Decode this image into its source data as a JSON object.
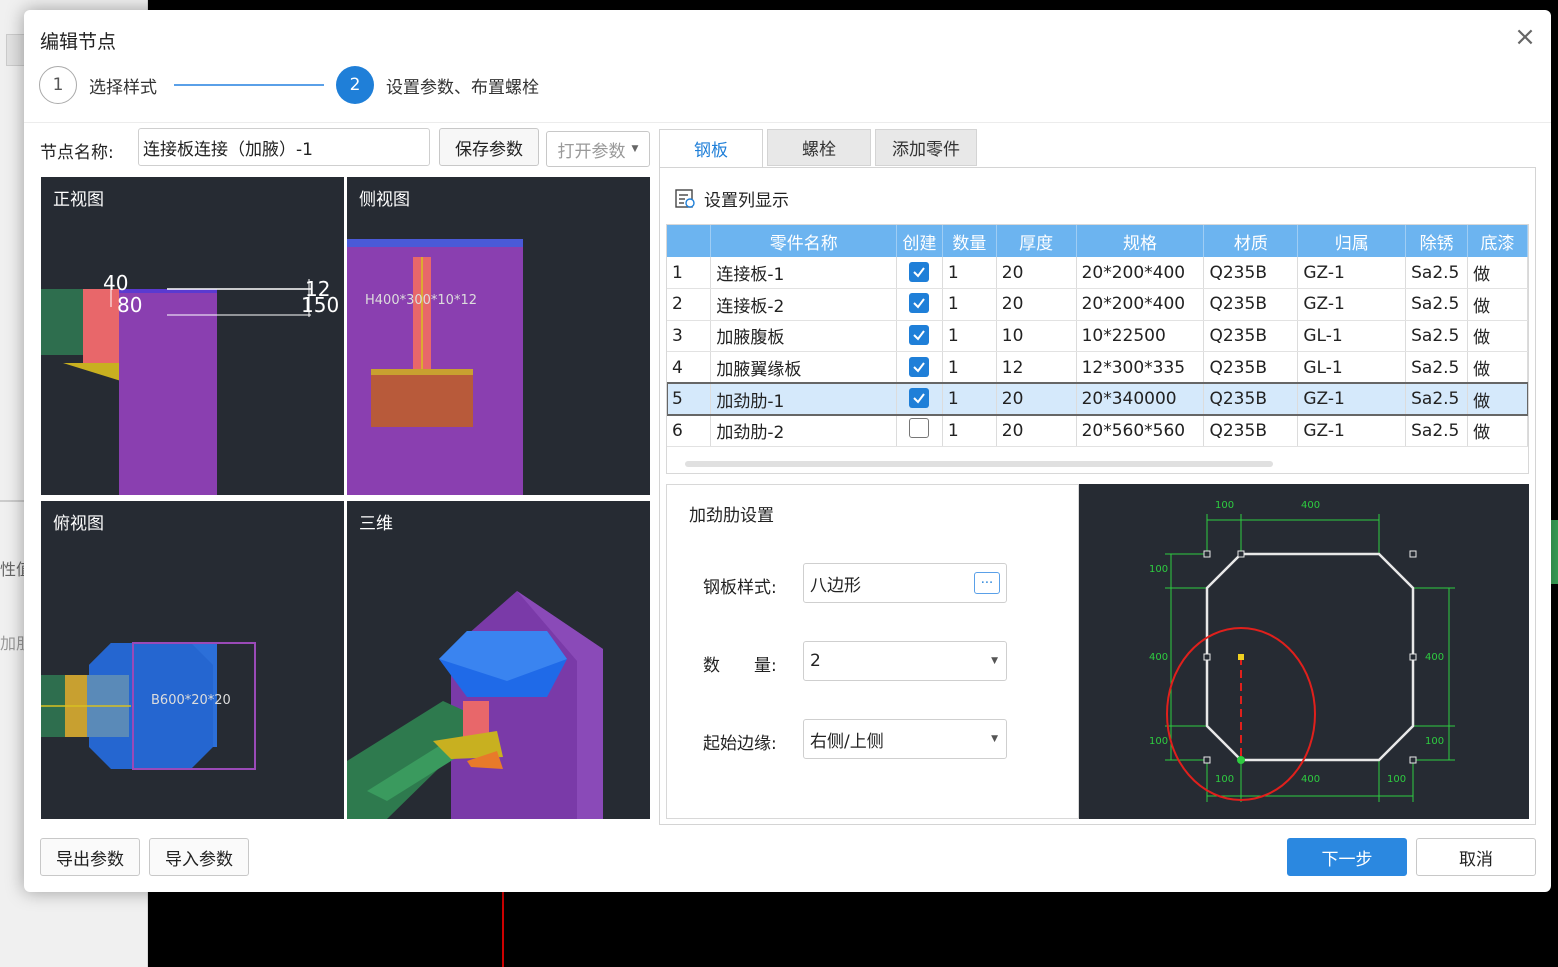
{
  "background": {
    "left_fragments": [
      "性值",
      "加朋"
    ]
  },
  "dialog": {
    "title": "编辑节点",
    "close_glyph": "×"
  },
  "stepper": {
    "steps": [
      {
        "number": "1",
        "label": "选择样式",
        "active": false
      },
      {
        "number": "2",
        "label": "设置参数、布置螺栓",
        "active": true
      }
    ]
  },
  "node": {
    "name_label": "节点名称:",
    "name_value": "连接板连接（加腋）-1",
    "save_label": "保存参数",
    "open_label": "打开参数"
  },
  "views": {
    "front": {
      "title": "正视图",
      "dims": [
        "40",
        "80",
        "12",
        "150"
      ]
    },
    "side": {
      "title": "侧视图",
      "label": "H400*300*10*12"
    },
    "top": {
      "title": "俯视图",
      "label": "B600*20*20"
    },
    "three_d": {
      "title": "三维"
    }
  },
  "tabs": [
    "钢板",
    "螺栓",
    "添加零件"
  ],
  "column_settings_label": "设置列显示",
  "table": {
    "headers": [
      "",
      "零件名称",
      "创建",
      "数量",
      "厚度",
      "规格",
      "材质",
      "归属",
      "除锈",
      "底漆"
    ],
    "rows": [
      {
        "idx": "1",
        "name": "连接板-1",
        "checked": true,
        "qty": "1",
        "thick": "20",
        "spec": "20*200*400",
        "mat": "Q235B",
        "owner": "GZ-1",
        "rust": "Sa2.5",
        "primer": "做"
      },
      {
        "idx": "2",
        "name": "连接板-2",
        "checked": true,
        "qty": "1",
        "thick": "20",
        "spec": "20*200*400",
        "mat": "Q235B",
        "owner": "GZ-1",
        "rust": "Sa2.5",
        "primer": "做"
      },
      {
        "idx": "3",
        "name": "加腋腹板",
        "checked": true,
        "qty": "1",
        "thick": "10",
        "spec": "10*22500",
        "mat": "Q235B",
        "owner": "GL-1",
        "rust": "Sa2.5",
        "primer": "做"
      },
      {
        "idx": "4",
        "name": "加腋翼缘板",
        "checked": true,
        "qty": "1",
        "thick": "12",
        "spec": "12*300*335",
        "mat": "Q235B",
        "owner": "GL-1",
        "rust": "Sa2.5",
        "primer": "做"
      },
      {
        "idx": "5",
        "name": "加劲肋-1",
        "checked": true,
        "qty": "1",
        "thick": "20",
        "spec": "20*340000",
        "mat": "Q235B",
        "owner": "GZ-1",
        "rust": "Sa2.5",
        "primer": "做",
        "selected": true
      },
      {
        "idx": "6",
        "name": "加劲肋-2",
        "checked": false,
        "qty": "1",
        "thick": "20",
        "spec": "20*560*560",
        "mat": "Q235B",
        "owner": "GZ-1",
        "rust": "Sa2.5",
        "primer": "做"
      }
    ]
  },
  "stiffener": {
    "title": "加劲肋设置",
    "fields": [
      {
        "label": "钢板样式:",
        "value": "八边形",
        "control": "more"
      },
      {
        "label": "数　　量:",
        "value": "2",
        "control": "dropdown"
      },
      {
        "label": "起始边缘:",
        "value": "右侧/上侧",
        "control": "dropdown"
      }
    ],
    "preview_dims": {
      "top": [
        "100",
        "400"
      ],
      "left": [
        "100",
        "400",
        "100"
      ],
      "right": [
        "400",
        "100"
      ],
      "bottom": [
        "100",
        "400",
        "100"
      ]
    }
  },
  "footer": {
    "export_label": "导出参数",
    "import_label": "导入参数",
    "next_label": "下一步",
    "cancel_label": "取消"
  },
  "colors": {
    "accent": "#1f7fd8",
    "header_blue": "#6cb4f0",
    "view_bg": "#262b33",
    "purple": "#8a3fb0",
    "green_dim": "#2ecc40",
    "red_circle": "#e0201c"
  }
}
